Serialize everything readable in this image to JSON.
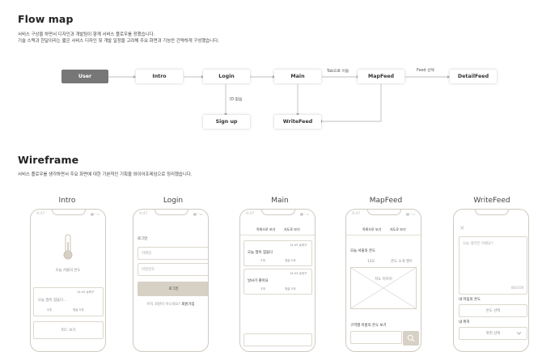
{
  "flow": {
    "title": "Flow map",
    "desc_line1": "서비스 구상을 하면서 디자인과 개발팀이 함께 서비스 플로우를 정했습니다.",
    "desc_line2": "기술 스택과 한달이라는 짧은 서비스 디자인 및 개발 일정을 고려해 주요 화면과 기능만 간략하게 구성했습니다.",
    "nodes": {
      "user": "User",
      "intro": "Intro",
      "login": "Login",
      "main": "Main",
      "mapfeed": "MapFeed",
      "detailfeed": "DetailFeed",
      "signup": "Sign up",
      "writefeed": "WriteFeed"
    },
    "edge_labels": {
      "tab_move": "Tab으로 이동",
      "feed_select": "Feed 선택",
      "id_none": "ID 없음"
    }
  },
  "wireframe": {
    "title": "Wireframe",
    "desc": "서비스 플로우를 생각하면서 주요 화면에 대한 기본적인 기획을 와이어프레임으로 정리했습니다.",
    "status_time": "9:47",
    "screens": {
      "intro": {
        "title": "Intro",
        "temp_label": "오늘 서울의 온도",
        "card_text": "오늘 많이 힘들다...",
        "card_meta": "14:45 송파구",
        "card_likes": "3개",
        "card_comments": "댓글 5개",
        "bottom_text": "피드 보기"
      },
      "login": {
        "title": "Login",
        "heading": "로그인",
        "email_placeholder": "이메일",
        "password_placeholder": "비밀번호",
        "login_button": "로그인",
        "signup_prompt": "아직 회원이 아니세요?",
        "signup_link": "회원가입"
      },
      "main": {
        "title": "Main",
        "tab_list": "목록으로 보기",
        "tab_map": "지도로 보기",
        "card1_text": "오늘 많이 힘들다",
        "card1_meta": "14:45 송파구",
        "card2_text": "날씨가 좋아요",
        "card2_meta": "14:33 송파구",
        "likes": "3개",
        "comments": "댓글 5개"
      },
      "mapfeed": {
        "title": "MapFeed",
        "tab_list": "목록으로 보기",
        "tab_map": "지도로 보기",
        "temp_label": "오늘 서울의 온도",
        "temp_value": "13도",
        "temp_desc": "온도 소개 멘트",
        "map_image": "지도 이미지",
        "district_label": "구역별 이름의 온도 보기"
      },
      "writefeed": {
        "title": "WriteFeed",
        "close": "×",
        "input_placeholder": "오늘 생각은 어때요?",
        "char_count": "80/100",
        "my_temp_label": "내 마음의 온도",
        "temp_select": "온도 선택",
        "my_location_label": "내 위치",
        "location_select": "위치 선택"
      }
    }
  }
}
